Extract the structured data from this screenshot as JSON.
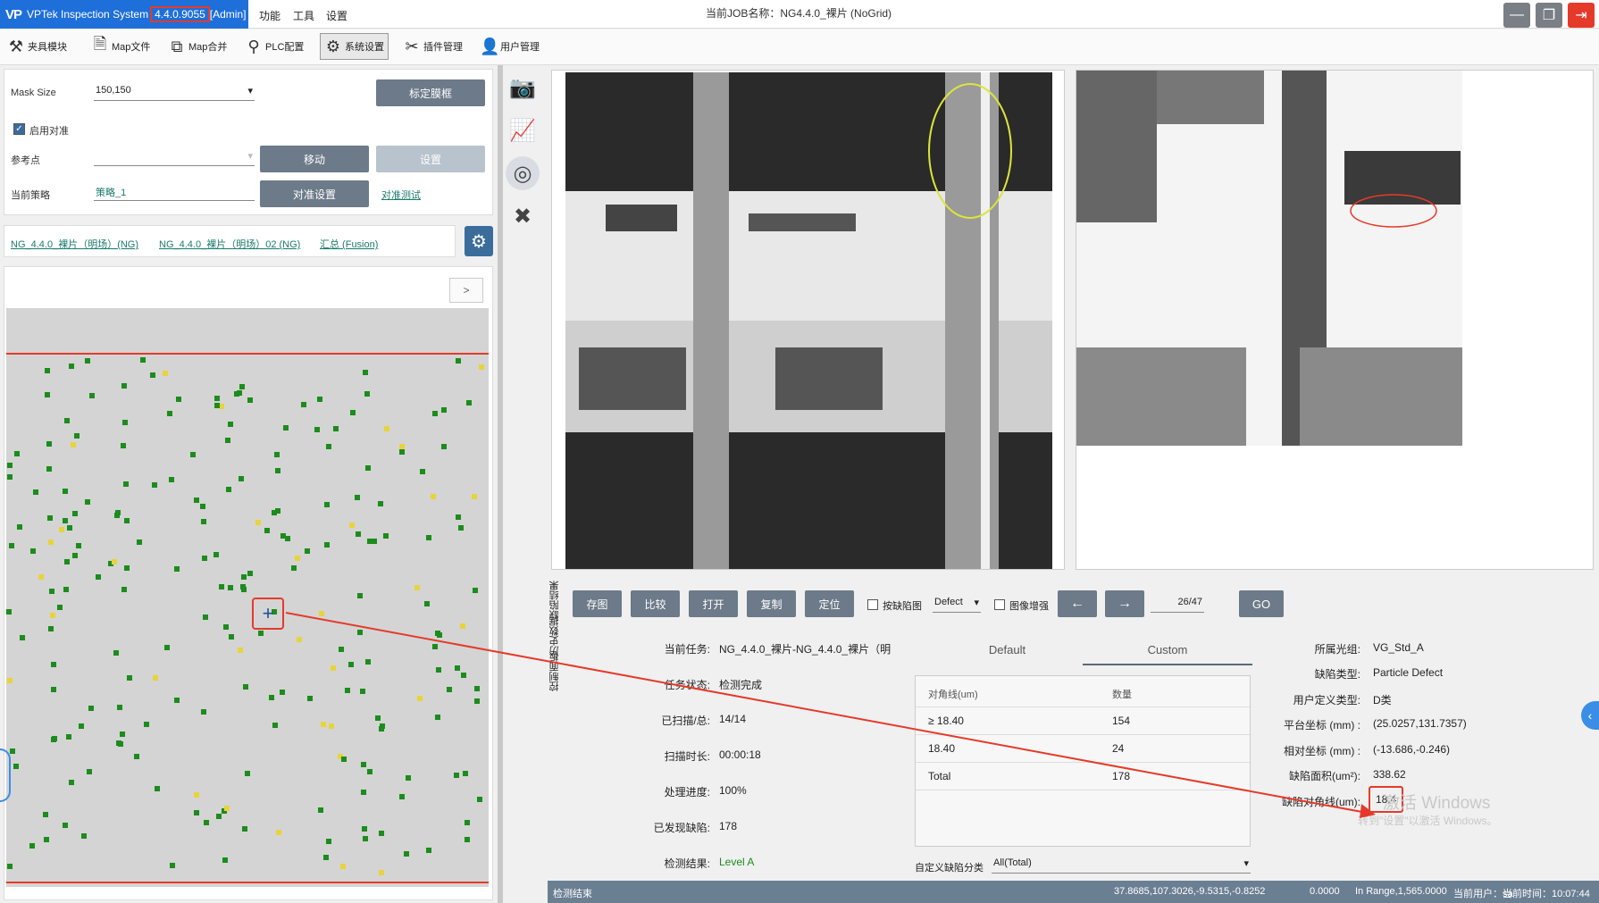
{
  "titlebar": {
    "app_name": "VPTek Inspection System",
    "version": "4.4.0.9055",
    "role": "[Admin]",
    "menus": [
      "功能",
      "工具",
      "设置"
    ],
    "job_label": "当前JOB名称：NG4.4.0_裸片 (NoGrid)"
  },
  "toolbar": {
    "items": [
      "夹具模块",
      "Map文件",
      "Map合并",
      "PLC配置",
      "系统设置",
      "插件管理",
      "用户管理"
    ]
  },
  "align_panel": {
    "mask_size_label": "Mask Size",
    "mask_size_value": "150,150",
    "calib_button": "标定膜框",
    "enable_align_label": "启用对准",
    "ref_point_label": "参考点",
    "move_button": "移动",
    "set_button": "设置",
    "strategy_label": "当前策略",
    "strategy_value": "策略_1",
    "align_settings_button": "对准设置",
    "align_test_link": "对准测试"
  },
  "tabs": {
    "items": [
      "NG_4.4.0_裸片（明场）(NG)",
      "NG_4.4.0_裸片（明场）02 (NG)",
      "汇总 (Fusion)"
    ]
  },
  "map": {
    "collapse_label": ">"
  },
  "vertical_tabs": [
    "控制面板",
    "历史数据",
    "缺陷结果"
  ],
  "controls": {
    "buttons": [
      "存图",
      "比较",
      "打开",
      "复制",
      "定位"
    ],
    "by_defect_label": "按缺陷图",
    "defect_select": "Defect",
    "enhance_label": "图像增强",
    "prev_arrow": "←",
    "next_arrow": "→",
    "page_counter": "26/47",
    "go_button": "GO"
  },
  "task_info": {
    "labels": [
      "当前任务:",
      "任务状态:",
      "已扫描/总:",
      "扫描时长:",
      "处理进度:",
      "已发现缺陷:",
      "检测结果:"
    ],
    "values": [
      "NG_4.4.0_裸片-NG_4.4.0_裸片（明",
      "检测完成",
      "14/14",
      "00:00:18",
      "100%",
      "178",
      "Level A"
    ]
  },
  "stats": {
    "tabs": [
      "Default",
      "Custom"
    ],
    "headers": [
      "对角线(um)",
      "数量"
    ],
    "rows": [
      [
        "≥ 18.40",
        "154"
      ],
      [
        "18.40",
        "24"
      ],
      [
        "Total",
        "178"
      ]
    ],
    "category_label": "自定义缺陷分类",
    "category_value": "All(Total)"
  },
  "defect_info": {
    "labels": [
      "所属光组:",
      "缺陷类型:",
      "用户定义类型:",
      "平台坐标 (mm) :",
      "相对坐标 (mm) :",
      "缺陷面积(um²):",
      "缺陷对角线(um):"
    ],
    "values": [
      "VG_Std_A",
      "Particle Defect",
      "D类",
      "(25.0257,131.7357)",
      "(-13.686,-0.246)",
      "338.62",
      "18.4"
    ]
  },
  "watermark": {
    "line1": "激活 Windows",
    "line2": "转到\"设置\"以激活 Windows。"
  },
  "statusbar": {
    "left": "检测结束",
    "coords": "37.8685,107.3026,-9.5315,-0.8252",
    "value": "0.0000",
    "range": "In Range,1,565.0000",
    "user": "当前用户：sa",
    "time": "当前时间：10:07:44"
  },
  "colors": {
    "accent_blue": "#1e6fd9",
    "highlight_red": "#e53a2a",
    "status_bar": "#6b7f93",
    "good_die": "#1c8c1c",
    "warn_die": "#e8d33a"
  },
  "icons": [
    "camera-icon",
    "chart-icon",
    "globe-icon",
    "tools-icon",
    "gear-icon",
    "exit-icon",
    "minimize-icon",
    "restore-icon",
    "plus-icon"
  ]
}
